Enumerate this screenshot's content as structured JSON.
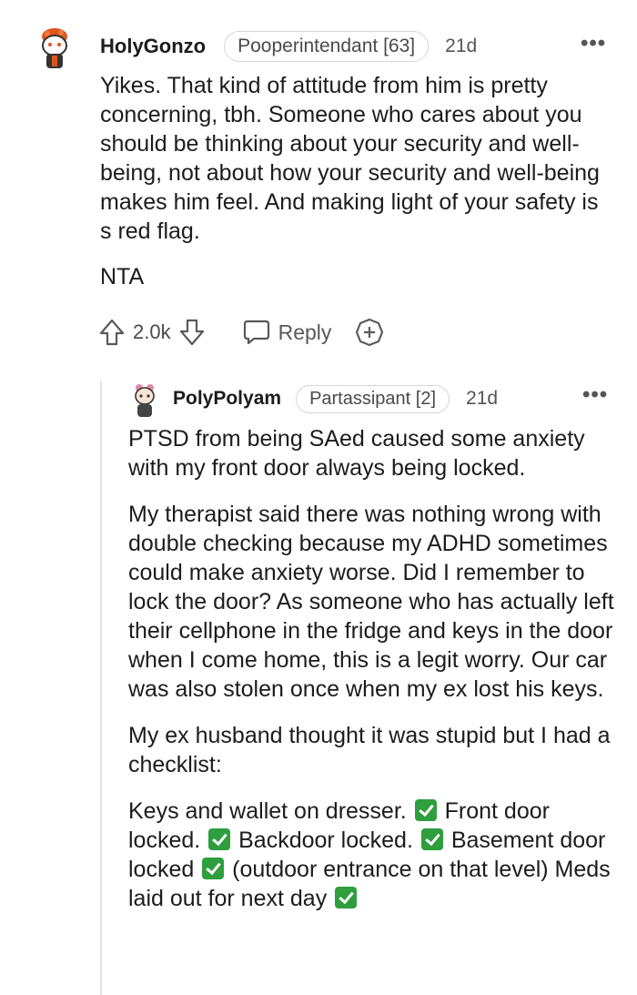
{
  "comment1": {
    "username": "HolyGonzo",
    "flair": "Pooperintendant [63]",
    "age": "21d",
    "more": "•••",
    "paragraphs": [
      "Yikes. That kind of attitude from him is pretty concerning, tbh. Someone who cares about you should be thinking about your security and well-being, not about how your security and well-being makes him feel. And making light of your safety is s red flag.",
      "NTA"
    ],
    "votes": "2.0k",
    "reply_label": "Reply"
  },
  "comment2": {
    "username": "PolyPolyam",
    "flair": "Partassipant [2]",
    "age": "21d",
    "more": "•••",
    "paragraphs": [
      "PTSD from being SAed caused some anxiety with my front door always being locked.",
      "My therapist said there was nothing wrong with double checking because my ADHD sometimes could make anxiety worse. Did I remember to lock the door? As someone who has actually left their cellphone in the fridge and keys in the door when I come home, this is a legit worry. Our car was also stolen once when my ex lost his keys.",
      "My ex husband thought it was stupid but I had a checklist:"
    ],
    "checklist": [
      "Keys and wallet on dresser.",
      "Front door locked.",
      "Backdoor locked.",
      "Basement door locked",
      "(outdoor entrance on that level) Meds laid out for next day"
    ],
    "check_icon": "check-mark-icon"
  },
  "colors": {
    "text": "#1c1c1c",
    "meta": "#555555",
    "check": "#2e9e3e",
    "thread_line": "#e3e3e3"
  }
}
